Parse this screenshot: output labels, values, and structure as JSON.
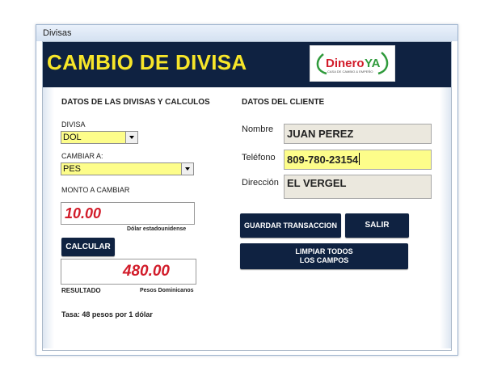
{
  "window": {
    "title": "Divisas"
  },
  "banner": {
    "title": "CAMBIO DE DIVISA",
    "logo_text": "DineroYA",
    "logo_subtext": "CASA DE CAMBIO & EMPEÑO",
    "colors": {
      "background": "#0f2241",
      "title": "#f7e629"
    }
  },
  "left": {
    "heading": "DATOS DE LAS DIVISAS Y CALCULOS",
    "divisa_label": "DIVISA",
    "divisa_value": "DOL",
    "cambiar_label": "CAMBIAR A:",
    "cambiar_value": "PES",
    "monto_label": "MONTO A CAMBIAR",
    "monto_value": "10.00",
    "monto_caption": "Dólar estadounidense",
    "calcular_button": "CALCULAR",
    "result_value": "480.00",
    "result_label": "RESULTADO",
    "result_caption": "Pesos Dominicanos",
    "rate_text": "Tasa: 48 pesos por 1 dólar"
  },
  "right": {
    "heading": "DATOS DEL CLIENTE",
    "nombre_label": "Nombre",
    "nombre_value": "JUAN PEREZ",
    "telefono_label": "Teléfono",
    "telefono_value": "809-780-23154",
    "direccion_label": "Dirección",
    "direccion_value": "EL VERGEL",
    "guardar_button": "GUARDAR TRANSACCION",
    "salir_button": "SALIR",
    "limpiar_button_line1": "LIMPIAR TODOS",
    "limpiar_button_line2": "LOS CAMPOS"
  },
  "colors": {
    "field_yellow": "#fdfd8a",
    "field_grey": "#ebe8de",
    "amount_red": "#d21c2a"
  }
}
